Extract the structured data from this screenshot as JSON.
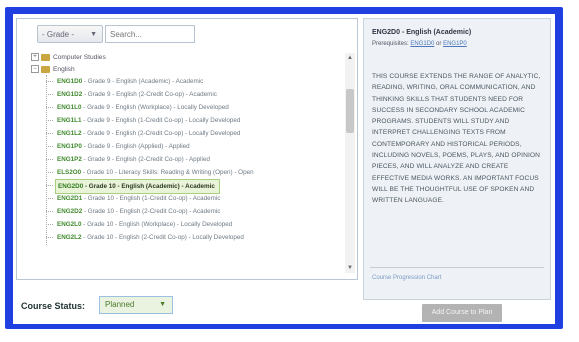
{
  "toolbar": {
    "grade_label": "- Grade -",
    "search_placeholder": "Search..."
  },
  "tree": {
    "folders": [
      {
        "name": "Computer Studies",
        "expanded": false
      },
      {
        "name": "English",
        "expanded": true
      }
    ],
    "courses": [
      {
        "code": "ENG1D0",
        "text": " - Grade 9 - English (Academic) - Academic",
        "selected": false
      },
      {
        "code": "ENG1D2",
        "text": " - Grade 9 - English (2-Credit Co-op) - Academic",
        "selected": false
      },
      {
        "code": "ENG1L0",
        "text": " - Grade 9 - English (Workplace) - Locally Developed",
        "selected": false
      },
      {
        "code": "ENG1L1",
        "text": " - Grade 9 - English (1-Credit Co-op) - Locally Developed",
        "selected": false
      },
      {
        "code": "ENG1L2",
        "text": " - Grade 9 - English (2-Credit Co-op) - Locally Developed",
        "selected": false
      },
      {
        "code": "ENG1P0",
        "text": " - Grade 9 - English (Applied) - Applied",
        "selected": false
      },
      {
        "code": "ENG1P2",
        "text": " - Grade 9 - English (2-Credit Co-op) - Applied",
        "selected": false
      },
      {
        "code": "ELS2O0",
        "text": " - Grade 10 - Literacy Skills: Reading & Writing (Open) - Open",
        "selected": false
      },
      {
        "code": "ENG2D0",
        "text": " - Grade 10 - English (Academic) - Academic",
        "selected": true
      },
      {
        "code": "ENG2D1",
        "text": " - Grade 10 - English (1-Credit Co-op) - Academic",
        "selected": false
      },
      {
        "code": "ENG2D2",
        "text": " - Grade 10 - English (2-Credit Co-op) - Academic",
        "selected": false
      },
      {
        "code": "ENG2L0",
        "text": " - Grade 10 - English (Workplace) - Locally Developed",
        "selected": false
      },
      {
        "code": "ENG2L2",
        "text": " - Grade 10 - English (2-Credit Co-op) - Locally Developed",
        "selected": false
      }
    ]
  },
  "status": {
    "label": "Course Status:",
    "value": "Planned"
  },
  "detail": {
    "title": "ENG2D0 - English (Academic)",
    "prereq_label": "Prerequisites:",
    "prereq_1": "ENG1D0",
    "prereq_or": "or",
    "prereq_2": "ENG1P0",
    "description": "THIS COURSE EXTENDS THE RANGE OF ANALYTIC, READING, WRITING, ORAL COMMUNICATION, AND THINKING SKILLS THAT STUDENTS NEED FOR SUCCESS IN SECONDARY SCHOOL ACADEMIC PROGRAMS. STUDENTS WILL STUDY AND INTERPRET CHALLENGING TEXTS FROM CONTEMPORARY AND HISTORICAL PERIODS, INCLUDING NOVELS, POEMS, PLAYS, AND OPINION PIECES, AND WILL ANALYZE AND CREATE EFFECTIVE MEDIA WORKS. AN IMPORTANT FOCUS WILL BE THE THOUGHTFUL USE OF SPOKEN AND WRITTEN LANGUAGE.",
    "chart_link": "Course Progression Chart"
  },
  "add_button": "Add Course to Plan",
  "colors": {
    "frame": "#1f3fe0",
    "course_code": "#3f8a2c",
    "selected_bg": "#e8f3d8"
  }
}
